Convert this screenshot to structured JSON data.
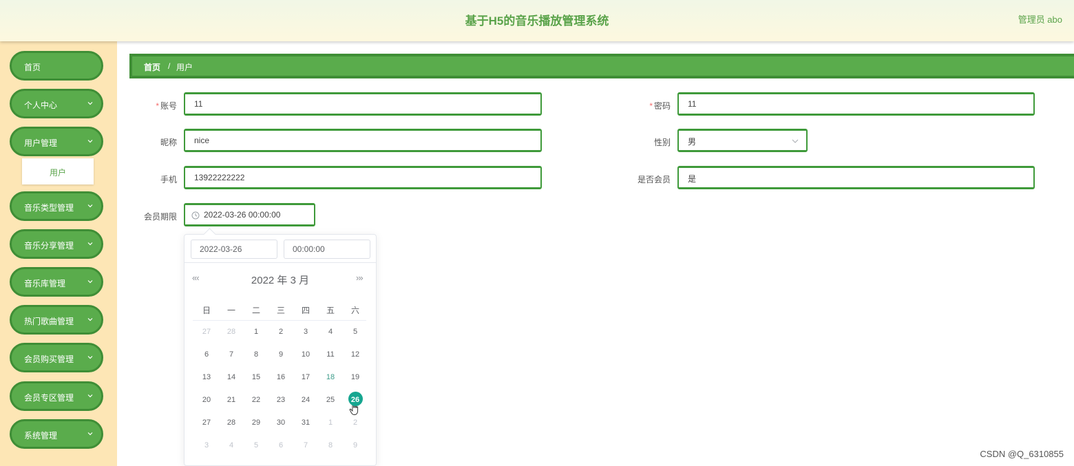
{
  "header": {
    "title": "基于H5的音乐播放管理系统",
    "user": "管理员 abo"
  },
  "sidebar": {
    "items": [
      {
        "label": "首页",
        "has_children": false
      },
      {
        "label": "个人中心",
        "has_children": true
      },
      {
        "label": "用户管理",
        "has_children": true,
        "expanded": true
      },
      {
        "label": "音乐类型管理",
        "has_children": true
      },
      {
        "label": "音乐分享管理",
        "has_children": true
      },
      {
        "label": "音乐库管理",
        "has_children": true
      },
      {
        "label": "热门歌曲管理",
        "has_children": true
      },
      {
        "label": "会员购买管理",
        "has_children": true
      },
      {
        "label": "会员专区管理",
        "has_children": true
      },
      {
        "label": "系统管理",
        "has_children": true
      }
    ],
    "submenu_label": "用户"
  },
  "breadcrumb": {
    "home": "首页",
    "separator": "/",
    "current": "用户"
  },
  "form": {
    "account": {
      "label": "账号",
      "required_mark": "*",
      "value": "11"
    },
    "password": {
      "label": "密码",
      "required_mark": "*",
      "value": "11"
    },
    "nickname": {
      "label": "昵称",
      "value": "nice"
    },
    "gender": {
      "label": "性别",
      "value": "男"
    },
    "phone": {
      "label": "手机",
      "value": "13922222222"
    },
    "is_member": {
      "label": "是否会员",
      "value": "是"
    },
    "member_expiry": {
      "label": "会员期限",
      "value": "2022-03-26 00:00:00"
    }
  },
  "datepicker": {
    "date_input": "2022-03-26",
    "time_input": "00:00:00",
    "header": "2022 年  3 月",
    "prev_nav": "«‹",
    "next_nav": "›»",
    "weekdays": [
      "日",
      "一",
      "二",
      "三",
      "四",
      "五",
      "六"
    ],
    "weeks": [
      [
        {
          "d": "27",
          "t": "prev"
        },
        {
          "d": "28",
          "t": "prev"
        },
        {
          "d": "1"
        },
        {
          "d": "2"
        },
        {
          "d": "3"
        },
        {
          "d": "4"
        },
        {
          "d": "5"
        }
      ],
      [
        {
          "d": "6"
        },
        {
          "d": "7"
        },
        {
          "d": "8"
        },
        {
          "d": "9"
        },
        {
          "d": "10"
        },
        {
          "d": "11"
        },
        {
          "d": "12"
        }
      ],
      [
        {
          "d": "13"
        },
        {
          "d": "14"
        },
        {
          "d": "15"
        },
        {
          "d": "16"
        },
        {
          "d": "17"
        },
        {
          "d": "18",
          "t": "today"
        },
        {
          "d": "19"
        }
      ],
      [
        {
          "d": "20"
        },
        {
          "d": "21"
        },
        {
          "d": "22"
        },
        {
          "d": "23"
        },
        {
          "d": "24"
        },
        {
          "d": "25"
        },
        {
          "d": "26",
          "t": "selected"
        }
      ],
      [
        {
          "d": "27"
        },
        {
          "d": "28"
        },
        {
          "d": "29"
        },
        {
          "d": "30"
        },
        {
          "d": "31"
        },
        {
          "d": "1",
          "t": "next"
        },
        {
          "d": "2",
          "t": "next"
        }
      ],
      [
        {
          "d": "3",
          "t": "next"
        },
        {
          "d": "4",
          "t": "next"
        },
        {
          "d": "5",
          "t": "next"
        },
        {
          "d": "6",
          "t": "next"
        },
        {
          "d": "7",
          "t": "next"
        },
        {
          "d": "8",
          "t": "next"
        },
        {
          "d": "9",
          "t": "next"
        }
      ]
    ]
  },
  "watermark": "CSDN @Q_6310855",
  "colors": {
    "primary_green": "#5aac4c",
    "border_green": "#3f8e36",
    "sidebar_bg": "#fde6b5",
    "selected_day": "#16a690"
  }
}
